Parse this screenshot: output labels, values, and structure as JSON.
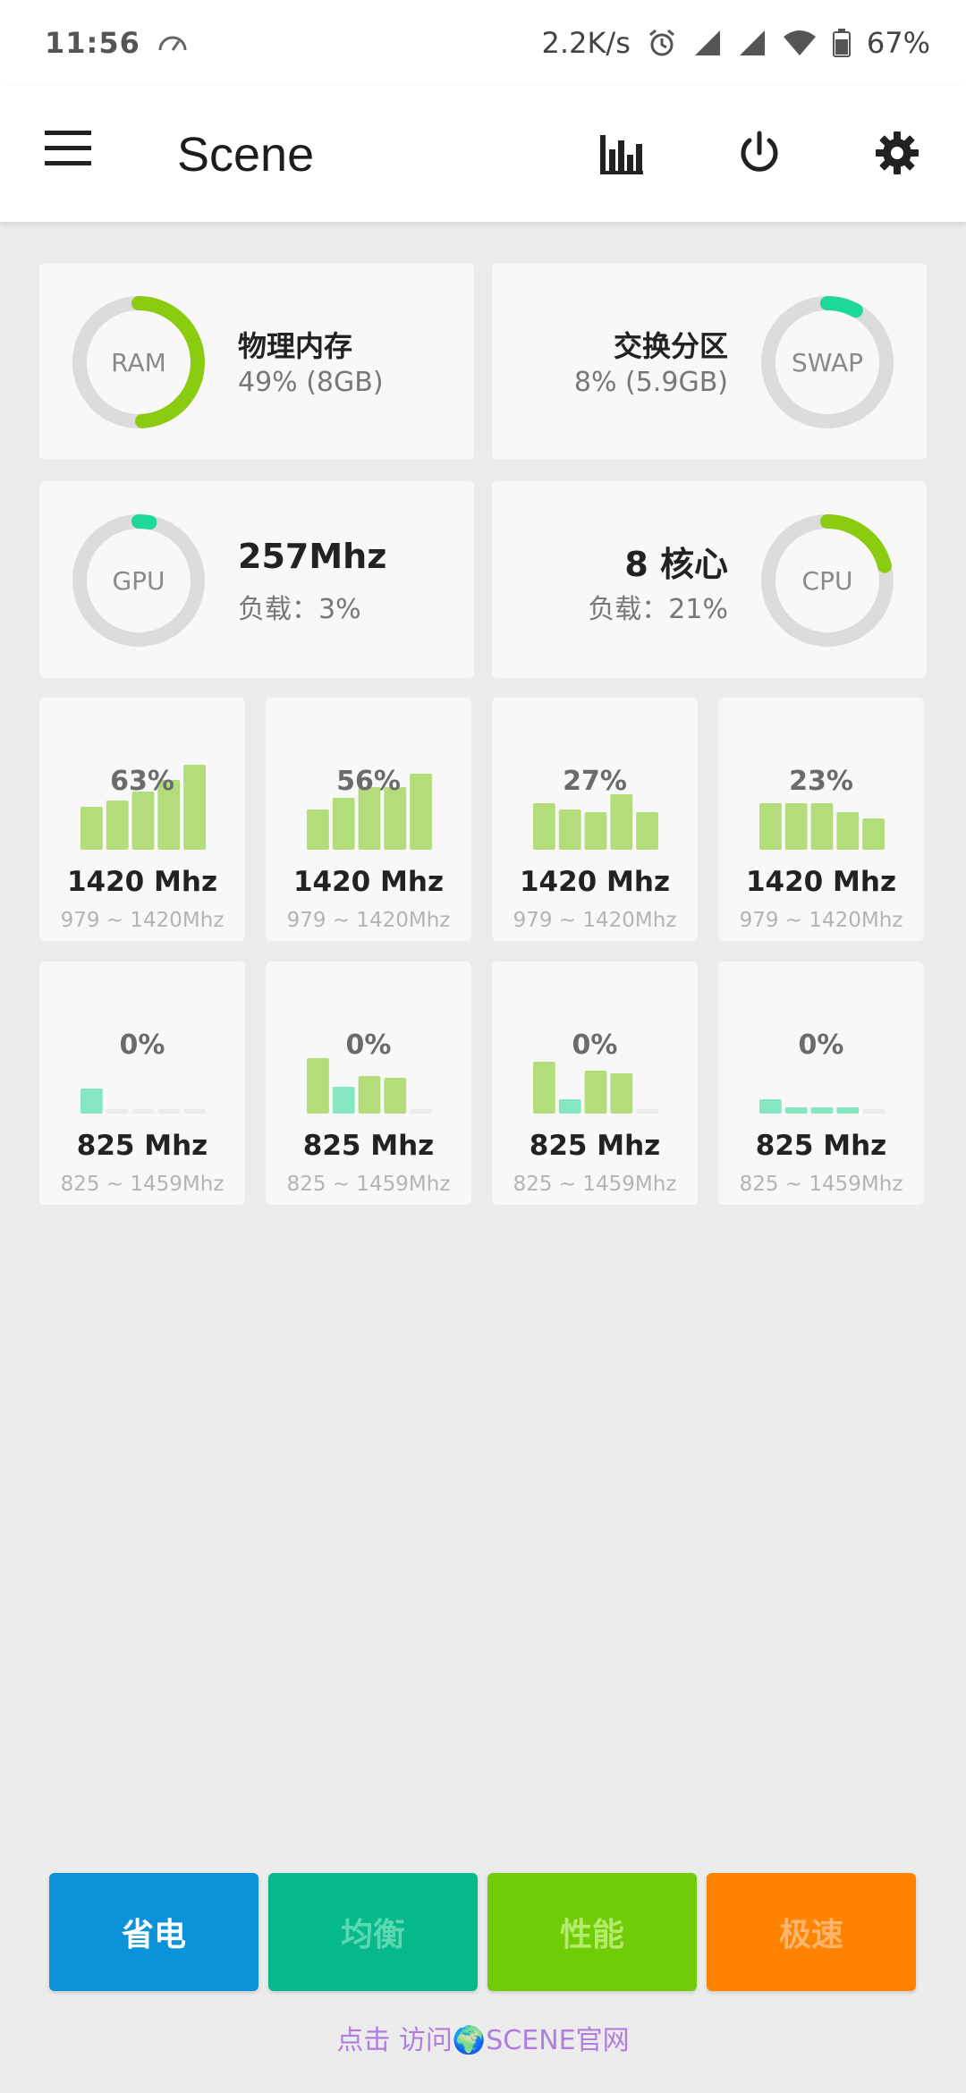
{
  "status_bar": {
    "time": "11:56",
    "net_speed": "2.2K/s",
    "battery": "67%"
  },
  "app_bar": {
    "title": "Scene",
    "icons": [
      "menu-icon",
      "bar-chart-icon",
      "power-icon",
      "gear-icon"
    ]
  },
  "memory": {
    "ram": {
      "ring_label": "RAM",
      "title": "物理内存",
      "detail": "49% (8GB)",
      "percent": 49,
      "color": "#8bcc11"
    },
    "swap": {
      "ring_label": "SWAP",
      "title": "交换分区",
      "detail": "8% (5.9GB)",
      "percent": 8,
      "color": "#1dd89a"
    }
  },
  "processor": {
    "gpu": {
      "ring_label": "GPU",
      "title": "257Mhz",
      "detail": "负载：3%",
      "percent": 3,
      "color": "#1dd89a"
    },
    "cpu": {
      "ring_label": "CPU",
      "title": "8 核心",
      "detail": "负载：21%",
      "percent": 21,
      "color": "#8bcc11"
    }
  },
  "cores": [
    {
      "load": "63%",
      "freq": "1420 Mhz",
      "range": "979 ~ 1420Mhz",
      "bars": [
        0.48,
        0.55,
        0.65,
        0.78,
        0.95
      ]
    },
    {
      "load": "56%",
      "freq": "1420 Mhz",
      "range": "979 ~ 1420Mhz",
      "bars": [
        0.45,
        0.58,
        0.7,
        0.7,
        0.85
      ]
    },
    {
      "load": "27%",
      "freq": "1420 Mhz",
      "range": "979 ~ 1420Mhz",
      "bars": [
        0.52,
        0.45,
        0.42,
        0.62,
        0.42
      ]
    },
    {
      "load": "23%",
      "freq": "1420 Mhz",
      "range": "979 ~ 1420Mhz",
      "bars": [
        0.52,
        0.52,
        0.52,
        0.42,
        0.35
      ]
    },
    {
      "load": "0%",
      "freq": "825 Mhz",
      "range": "825 ~ 1459Mhz",
      "bars": [
        0.28,
        0.05,
        0.05,
        0.05,
        0.05
      ]
    },
    {
      "load": "0%",
      "freq": "825 Mhz",
      "range": "825 ~ 1459Mhz",
      "bars": [
        0.62,
        0.3,
        0.42,
        0.4,
        0.05
      ]
    },
    {
      "load": "0%",
      "freq": "825 Mhz",
      "range": "825 ~ 1459Mhz",
      "bars": [
        0.58,
        0.16,
        0.48,
        0.45,
        0.05
      ]
    },
    {
      "load": "0%",
      "freq": "825 Mhz",
      "range": "825 ~ 1459Mhz",
      "bars": [
        0.16,
        0.07,
        0.07,
        0.07,
        0.05
      ]
    }
  ],
  "modes": [
    {
      "label": "省电",
      "bg": "#0b92d9",
      "fg": "#ffffff"
    },
    {
      "label": "均衡",
      "bg": "#06b98a",
      "fg": "#5bd8b1"
    },
    {
      "label": "性能",
      "bg": "#6fcc06",
      "fg": "#b3ec6a"
    },
    {
      "label": "极速",
      "bg": "#ff8200",
      "fg": "#ffb56b"
    }
  ],
  "footer": {
    "link_text": "点击 访问🌍SCENE官网"
  }
}
